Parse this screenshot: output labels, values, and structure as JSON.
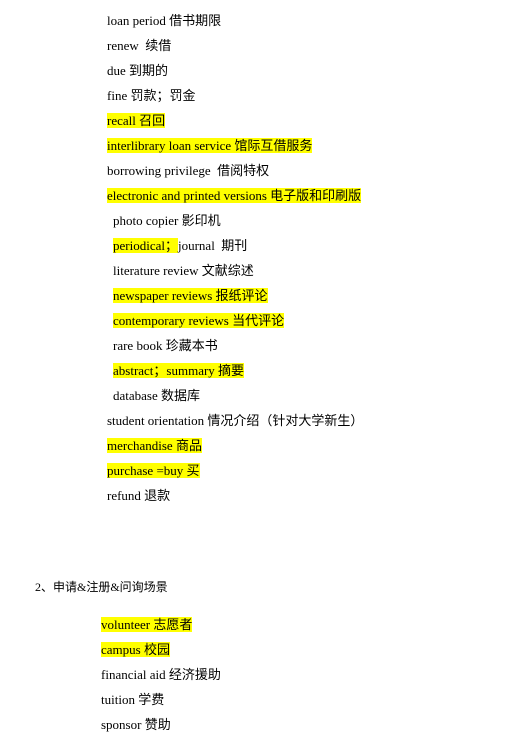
{
  "highlight_color": "#ffff00",
  "list1": [
    {
      "indent": false,
      "segments": [
        {
          "text": "loan period 借书期限",
          "hl": false
        }
      ]
    },
    {
      "indent": false,
      "segments": [
        {
          "text": "renew  续借",
          "hl": false
        }
      ]
    },
    {
      "indent": false,
      "segments": [
        {
          "text": "due 到期的",
          "hl": false
        }
      ]
    },
    {
      "indent": false,
      "segments": [
        {
          "text": "fine 罚款；罚金",
          "hl": false
        }
      ]
    },
    {
      "indent": false,
      "segments": [
        {
          "text": "recall 召回",
          "hl": true
        }
      ]
    },
    {
      "indent": false,
      "segments": [
        {
          "text": "interlibrary loan service 馆际互借服务",
          "hl": true
        }
      ]
    },
    {
      "indent": false,
      "segments": [
        {
          "text": "borrowing privilege  借阅特权",
          "hl": false
        }
      ]
    },
    {
      "indent": false,
      "segments": [
        {
          "text": "electronic and printed versions 电子版和印刷版",
          "hl": true
        }
      ]
    },
    {
      "indent": true,
      "segments": [
        {
          "text": "photo copier 影印机",
          "hl": false
        }
      ]
    },
    {
      "indent": true,
      "segments": [
        {
          "text": "periodical；",
          "hl": true
        },
        {
          "text": "journal  期刊",
          "hl": false
        }
      ]
    },
    {
      "indent": true,
      "segments": [
        {
          "text": "literature review 文献综述",
          "hl": false
        }
      ]
    },
    {
      "indent": true,
      "segments": [
        {
          "text": "newspaper reviews 报纸评论",
          "hl": true
        }
      ]
    },
    {
      "indent": true,
      "segments": [
        {
          "text": "contemporary reviews 当代评论",
          "hl": true
        }
      ]
    },
    {
      "indent": true,
      "segments": [
        {
          "text": "rare book 珍藏本书",
          "hl": false
        }
      ]
    },
    {
      "indent": true,
      "segments": [
        {
          "text": "abstract；summary 摘要",
          "hl": true
        }
      ]
    },
    {
      "indent": true,
      "segments": [
        {
          "text": "database 数据库",
          "hl": false
        }
      ]
    },
    {
      "indent": false,
      "segments": [
        {
          "text": "student orientation 情况介绍（针对大学新生）",
          "hl": false
        }
      ]
    },
    {
      "indent": false,
      "segments": [
        {
          "text": "merchandise 商品",
          "hl": true
        }
      ]
    },
    {
      "indent": false,
      "segments": [
        {
          "text": "purchase =buy 买",
          "hl": true
        }
      ]
    },
    {
      "indent": false,
      "segments": [
        {
          "text": "refund 退款",
          "hl": false
        }
      ]
    }
  ],
  "section2": {
    "heading": "2、申请&注册&问询场景",
    "items": [
      {
        "segments": [
          {
            "text": "volunteer 志愿者",
            "hl": true
          }
        ]
      },
      {
        "segments": [
          {
            "text": "campus 校园",
            "hl": true
          }
        ]
      },
      {
        "segments": [
          {
            "text": "financial aid 经济援助",
            "hl": false
          }
        ]
      },
      {
        "segments": [
          {
            "text": "tuition 学费",
            "hl": false
          }
        ]
      },
      {
        "segments": [
          {
            "text": "sponsor 赞助",
            "hl": false
          }
        ]
      }
    ]
  }
}
